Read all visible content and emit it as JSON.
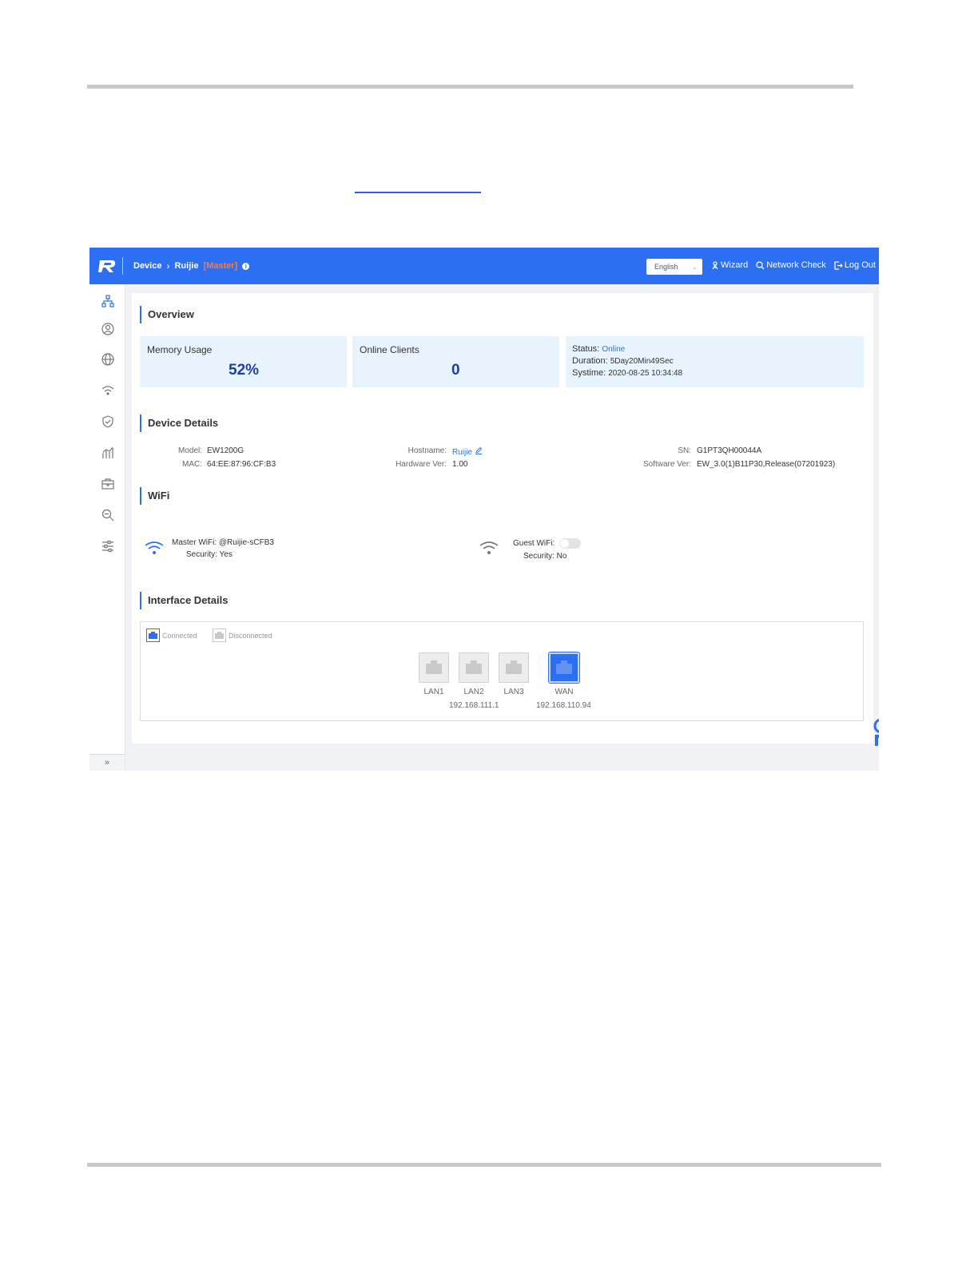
{
  "app": {
    "nav": {
      "device_label": "Device",
      "device_name": "Ruijie",
      "role": "[Master]",
      "info_glyph": "i"
    },
    "language": {
      "selected": "English"
    },
    "actions": {
      "wizard": "Wizard",
      "network_check": "Network Check",
      "logout": "Log Out"
    },
    "sidebar": {
      "items": [
        "network-topology-icon",
        "user-icon",
        "globe-icon",
        "wifi-icon",
        "shield-icon",
        "chart-icon",
        "toolbox-icon",
        "diagnose-icon",
        "settings-sliders-icon"
      ],
      "collapse": "»"
    }
  },
  "overview": {
    "title": "Overview",
    "memory": {
      "label": "Memory Usage",
      "value": "52%"
    },
    "clients": {
      "label": "Online Clients",
      "value": "0"
    },
    "status": {
      "status_label": "Status:",
      "status_value": "Online",
      "duration_label": "Duration:",
      "duration_value": "5Day20Min49Sec",
      "systime_label": "Systime:",
      "systime_value": "2020-08-25 10:34:48"
    }
  },
  "device": {
    "title": "Device Details",
    "model_label": "Model:",
    "model": "EW1200G",
    "mac_label": "MAC:",
    "mac": "64:EE:87:96:CF:B3",
    "hostname_label": "Hostname:",
    "hostname": "Ruijie",
    "hw_label": "Hardware Ver:",
    "hw": "1.00",
    "sn_label": "SN:",
    "sn": "G1PT3QH00044A",
    "sw_label": "Software Ver:",
    "sw": "EW_3.0(1)B11P30,Release(07201923)"
  },
  "wifi": {
    "title": "WiFi",
    "master_label": "Master WiFi:",
    "master_ssid": "@Ruijie-sCFB3",
    "master_security": "Security: Yes",
    "guest_label": "Guest WiFi:",
    "guest_security": "Security: No",
    "guest_enabled": false
  },
  "interfaces": {
    "title": "Interface Details",
    "legend_connected": "Connected",
    "legend_disconnected": "Disconnected",
    "ports": [
      {
        "name": "LAN1",
        "connected": false
      },
      {
        "name": "LAN2",
        "connected": false
      },
      {
        "name": "LAN3",
        "connected": false
      },
      {
        "name": "WAN",
        "connected": true
      }
    ],
    "lan_ip": "192.168.111.1",
    "wan_ip": "192.168.110.94"
  },
  "colors": {
    "brand": "#2d6ff2",
    "role": "#ff7a45",
    "card": "#e8f4fd",
    "value": "#1d3fa8"
  }
}
